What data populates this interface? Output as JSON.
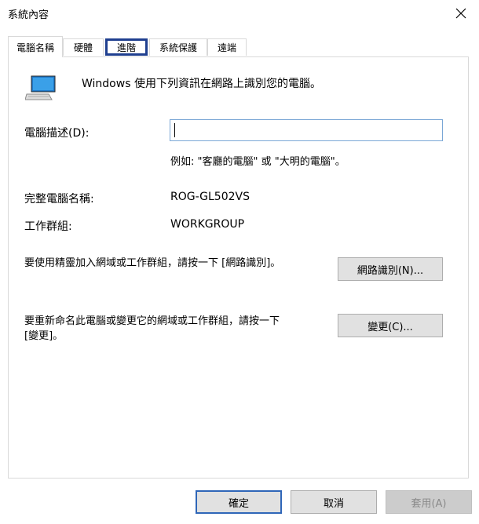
{
  "window": {
    "title": "系統內容",
    "close_glyph": "✕"
  },
  "tabs": [
    {
      "label": "電腦名稱"
    },
    {
      "label": "硬體"
    },
    {
      "label": "進階"
    },
    {
      "label": "系統保護"
    },
    {
      "label": "遠端"
    }
  ],
  "active_tab": "電腦名稱",
  "focused_tab": "進階",
  "main": {
    "intro": "Windows 使用下列資訊在網路上識別您的電腦。",
    "description_label": "電腦描述(D):",
    "description_value": "",
    "example": "例如: \"客廳的電腦\" 或 \"大明的電腦\"。",
    "full_name_label": "完整電腦名稱:",
    "full_name_value": "ROG-GL502VS",
    "workgroup_label": "工作群組:",
    "workgroup_value": "WORKGROUP",
    "network_id_text": "要使用精靈加入網域或工作群組，請按一下 [網路識別]。",
    "network_id_button": "網路識別(N)...",
    "rename_text": "要重新命名此電腦或變更它的網域或工作群組，請按一下 [變更]。",
    "change_button": "變更(C)..."
  },
  "footer": {
    "ok": "確定",
    "cancel": "取消",
    "apply": "套用(A)"
  },
  "colors": {
    "focus_outline": "#1f3f8f",
    "input_border": "#7aa7d6",
    "default_button_border": "#2f66b8",
    "button_face": "#e1e1e1"
  },
  "icons": {
    "computer": "computer-icon",
    "close": "close-icon"
  }
}
